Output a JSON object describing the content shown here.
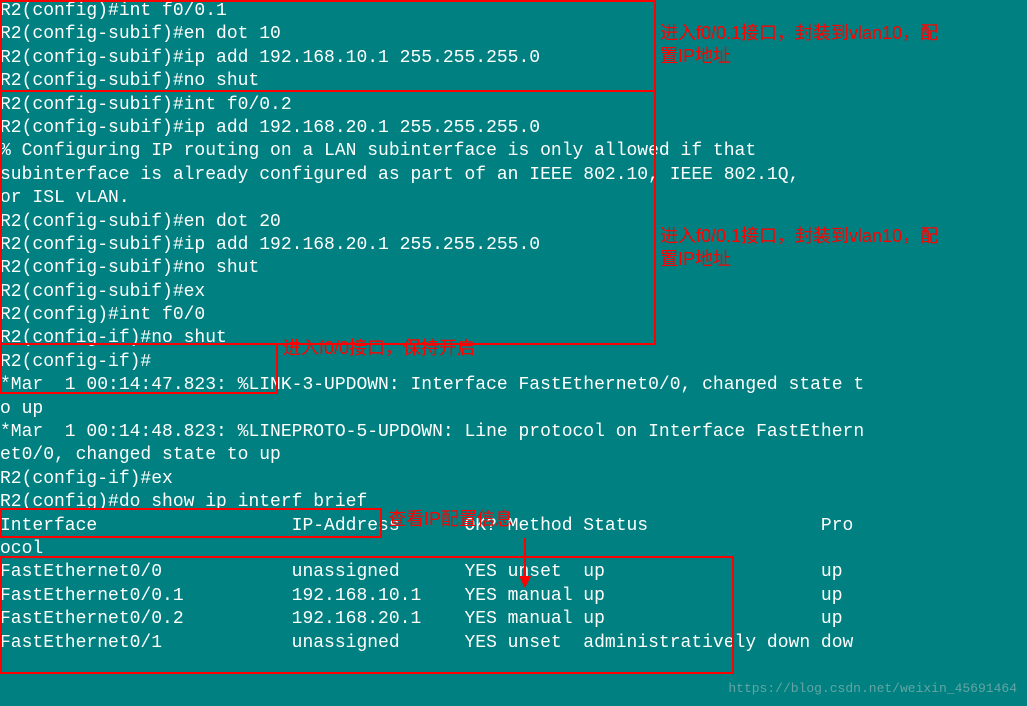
{
  "lines": {
    "l1": "R2(config)#int f0/0.1",
    "l2": "R2(config-subif)#en dot 10",
    "l3": "R2(config-subif)#ip add 192.168.10.1 255.255.255.0",
    "l4": "R2(config-subif)#no shut",
    "l5": "R2(config-subif)#int f0/0.2",
    "l6": "R2(config-subif)#ip add 192.168.20.1 255.255.255.0",
    "l7": "",
    "l8": "% Configuring IP routing on a LAN subinterface is only allowed if that",
    "l9": "subinterface is already configured as part of an IEEE 802.10, IEEE 802.1Q,",
    "l10": "or ISL vLAN.",
    "l11": "",
    "l12": "R2(config-subif)#en dot 20",
    "l13": "R2(config-subif)#ip add 192.168.20.1 255.255.255.0",
    "l14": "R2(config-subif)#no shut",
    "l15": "R2(config-subif)#ex",
    "l16": "R2(config)#int f0/0",
    "l17": "R2(config-if)#no shut",
    "l18": "R2(config-if)#",
    "l19": "*Mar  1 00:14:47.823: %LINK-3-UPDOWN: Interface FastEthernet0/0, changed state t",
    "l20": "o up",
    "l21": "*Mar  1 00:14:48.823: %LINEPROTO-5-UPDOWN: Line protocol on Interface FastEthern",
    "l22": "et0/0, changed state to up",
    "l23": "R2(config-if)#ex",
    "l24": "R2(config)#do show ip interf brief",
    "l25": "Interface                  IP-Address      OK? Method Status                Pro",
    "l26": "ocol",
    "l27": "FastEthernet0/0            unassigned      YES unset  up                    up ",
    "l28": "",
    "l29": "FastEthernet0/0.1          192.168.10.1    YES manual up                    up ",
    "l30": "",
    "l31": "FastEthernet0/0.2          192.168.20.1    YES manual up                    up ",
    "l32": "",
    "l33": "FastEthernet0/1            unassigned      YES unset  administratively down dow"
  },
  "annotations": {
    "a1l1": "进入f0/0.1接口，封装到vlan10，配",
    "a1l2": "置IP地址",
    "a2l1": "进入f0/0.1接口，封装到vlan10，配",
    "a2l2": "置IP地址",
    "a3": "进入f0/0接口，保持开启",
    "a4": "查看IP配置信息"
  },
  "watermark": "https://blog.csdn.net/weixin_45691464"
}
